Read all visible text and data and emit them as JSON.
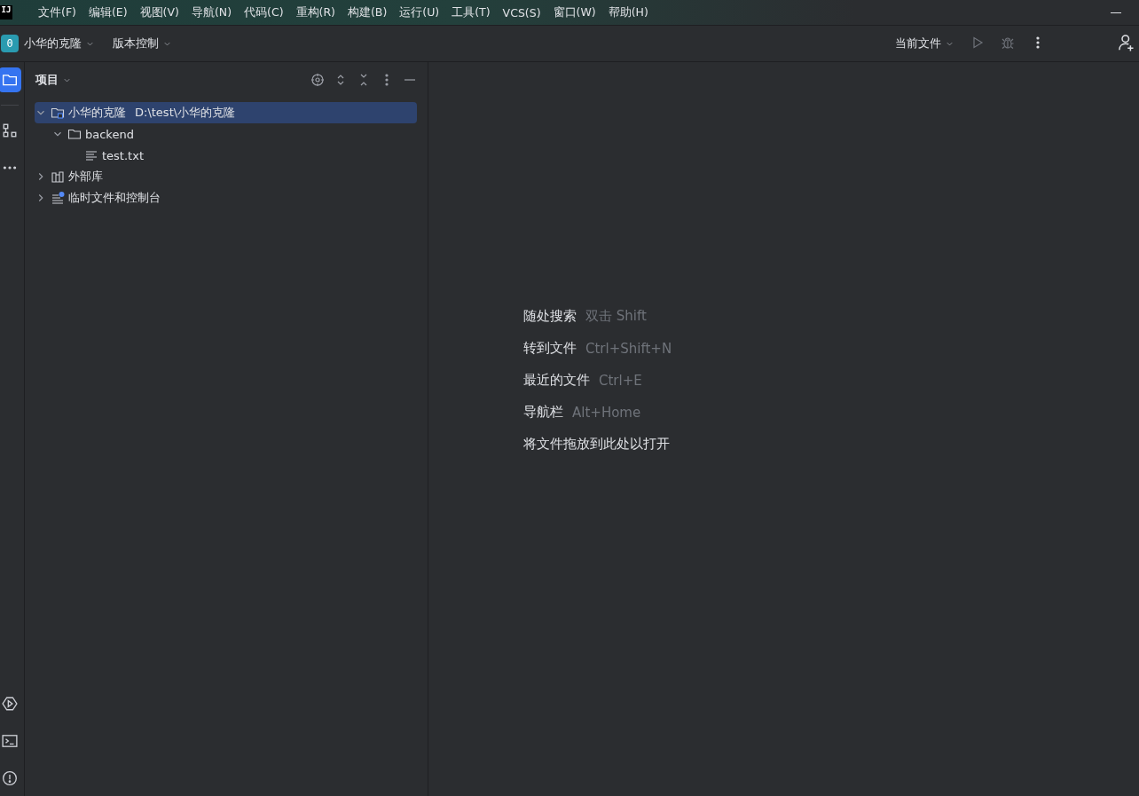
{
  "logo": {
    "text": "IJ"
  },
  "menu": [
    "文件(F)",
    "编辑(E)",
    "视图(V)",
    "导航(N)",
    "代码(C)",
    "重构(R)",
    "构建(B)",
    "运行(U)",
    "工具(T)",
    "VCS(S)",
    "窗口(W)",
    "帮助(H)"
  ],
  "toolbar": {
    "project_badge": "0",
    "project": "小华的克隆",
    "vcs": "版本控制",
    "run_config": "当前文件"
  },
  "left_strip": [
    {
      "kind": "folder",
      "selected": true
    },
    {
      "kind": "structure",
      "selected": false
    },
    {
      "kind": "more",
      "selected": false
    }
  ],
  "left_strip_bottom": [
    {
      "kind": "run"
    },
    {
      "kind": "terminal"
    },
    {
      "kind": "problems"
    }
  ],
  "project_panel": {
    "title": "项目",
    "tree": [
      {
        "kind": "module",
        "name": "小华的克隆",
        "path": "D:\\test\\小华的克隆",
        "expanded": true,
        "selected": true,
        "children": [
          {
            "kind": "folder",
            "name": "backend",
            "expanded": true,
            "selected": false,
            "children": [
              {
                "kind": "file",
                "name": "test.txt",
                "selected": false
              }
            ]
          }
        ]
      },
      {
        "kind": "library",
        "name": "外部库",
        "expanded": false,
        "selected": false
      },
      {
        "kind": "scratch",
        "name": "临时文件和控制台",
        "expanded": false,
        "selected": false
      }
    ]
  },
  "editor_hints": [
    {
      "action": "随处搜索",
      "shortcut": "双击 Shift"
    },
    {
      "action": "转到文件",
      "shortcut": "Ctrl+Shift+N"
    },
    {
      "action": "最近的文件",
      "shortcut": "Ctrl+E"
    },
    {
      "action": "导航栏",
      "shortcut": "Alt+Home"
    },
    {
      "action": "将文件拖放到此处以打开"
    }
  ]
}
